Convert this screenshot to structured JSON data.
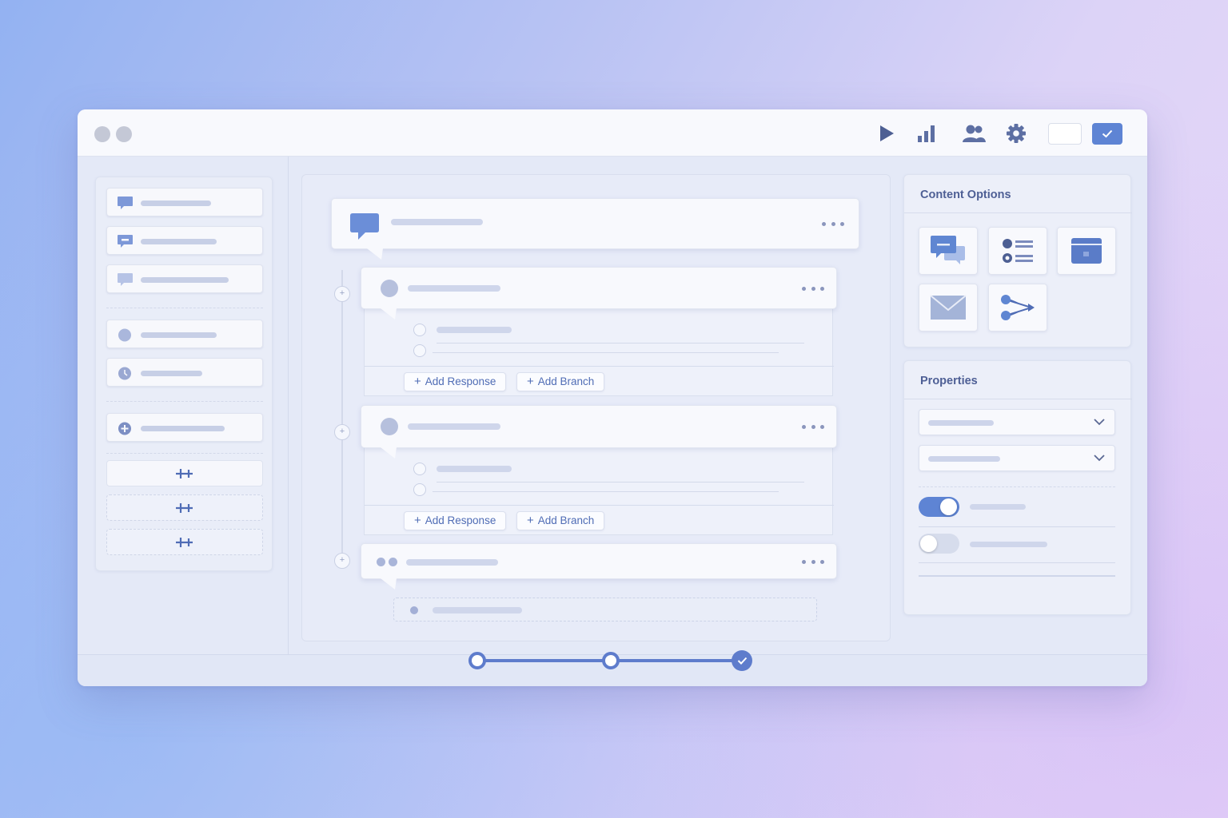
{
  "window": {
    "toolbar": {
      "icons": [
        "play-icon",
        "bar-chart-icon",
        "users-icon",
        "gear-icon",
        "blank-button",
        "check-button"
      ],
      "accent": "#5e84d4"
    }
  },
  "canvas": {
    "cards": [
      {
        "type": "message",
        "actions": []
      },
      {
        "type": "question",
        "actions": [
          {
            "label": "Add Response",
            "plus": "+"
          },
          {
            "label": "Add Branch",
            "plus": "+"
          }
        ]
      },
      {
        "type": "question",
        "actions": [
          {
            "label": "Add Response",
            "plus": "+"
          },
          {
            "label": "Add Branch",
            "plus": "+"
          }
        ]
      },
      {
        "type": "typing",
        "actions": []
      }
    ]
  },
  "content_options": {
    "title": "Content Options",
    "tiles": [
      "chat-bubbles-icon",
      "list-icon",
      "card-icon",
      "mail-icon",
      "branch-icon"
    ]
  },
  "properties": {
    "title": "Properties",
    "toggles": [
      {
        "on": true
      },
      {
        "on": false
      }
    ]
  },
  "stepper": {
    "steps": 3,
    "completed_step": 3
  },
  "colors": {
    "accent": "#5e7ccc",
    "icon_blue": "#6b8ed8",
    "text_blue": "#4f6cb5"
  }
}
